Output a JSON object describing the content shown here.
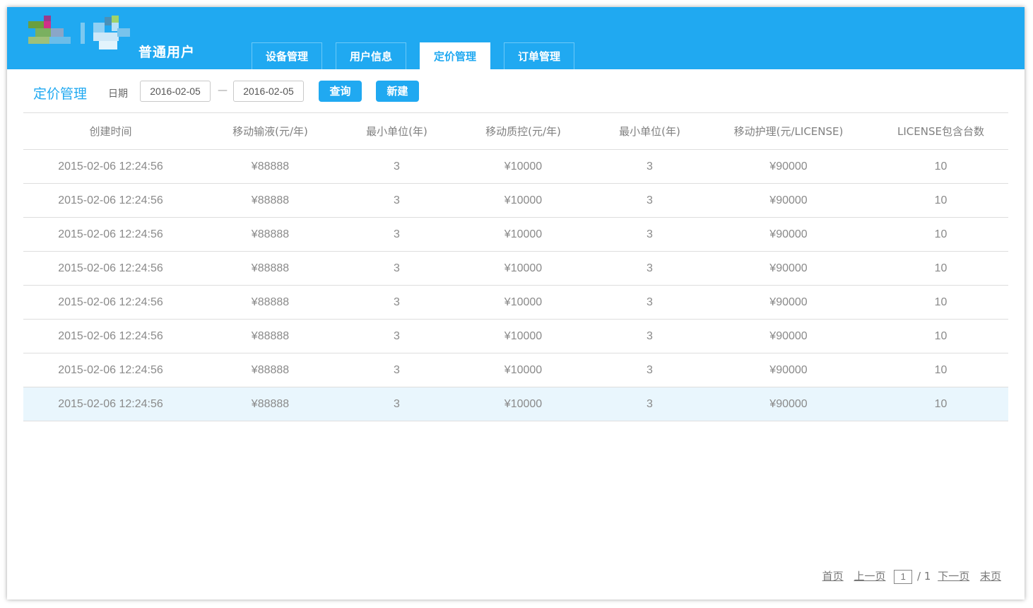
{
  "header": {
    "user_label": "普通用户",
    "tabs": [
      {
        "label": "设备管理",
        "active": false
      },
      {
        "label": "用户信息",
        "active": false
      },
      {
        "label": "定价管理",
        "active": true
      },
      {
        "label": "订单管理",
        "active": false
      }
    ]
  },
  "toolbar": {
    "title": "定价管理",
    "date_label": "日期",
    "start_date": "2016-02-05",
    "separator": "—",
    "end_date": "2016-02-05",
    "query_label": "查询",
    "new_label": "新建"
  },
  "table": {
    "columns": [
      "创建时间",
      "移动输液(元/年)",
      "最小单位(年)",
      "移动质控(元/年)",
      "最小单位(年)",
      "移动护理(元/LICENSE)",
      "LICENSE包含台数"
    ],
    "rows": [
      [
        "2015-02-06  12:24:56",
        "¥88888",
        "3",
        "¥10000",
        "3",
        "¥90000",
        "10"
      ],
      [
        "2015-02-06  12:24:56",
        "¥88888",
        "3",
        "¥10000",
        "3",
        "¥90000",
        "10"
      ],
      [
        "2015-02-06  12:24:56",
        "¥88888",
        "3",
        "¥10000",
        "3",
        "¥90000",
        "10"
      ],
      [
        "2015-02-06  12:24:56",
        "¥88888",
        "3",
        "¥10000",
        "3",
        "¥90000",
        "10"
      ],
      [
        "2015-02-06  12:24:56",
        "¥88888",
        "3",
        "¥10000",
        "3",
        "¥90000",
        "10"
      ],
      [
        "2015-02-06  12:24:56",
        "¥88888",
        "3",
        "¥10000",
        "3",
        "¥90000",
        "10"
      ],
      [
        "2015-02-06  12:24:56",
        "¥88888",
        "3",
        "¥10000",
        "3",
        "¥90000",
        "10"
      ],
      [
        "2015-02-06  12:24:56",
        "¥88888",
        "3",
        "¥10000",
        "3",
        "¥90000",
        "10"
      ]
    ],
    "highlighted_row": 7
  },
  "pager": {
    "first": "首页",
    "prev": "上一页",
    "current": "1",
    "total": "/ 1",
    "next": "下一页",
    "last": "末页"
  },
  "colors": {
    "accent": "#20a9f1",
    "highlight_row": "#e9f6fd"
  }
}
